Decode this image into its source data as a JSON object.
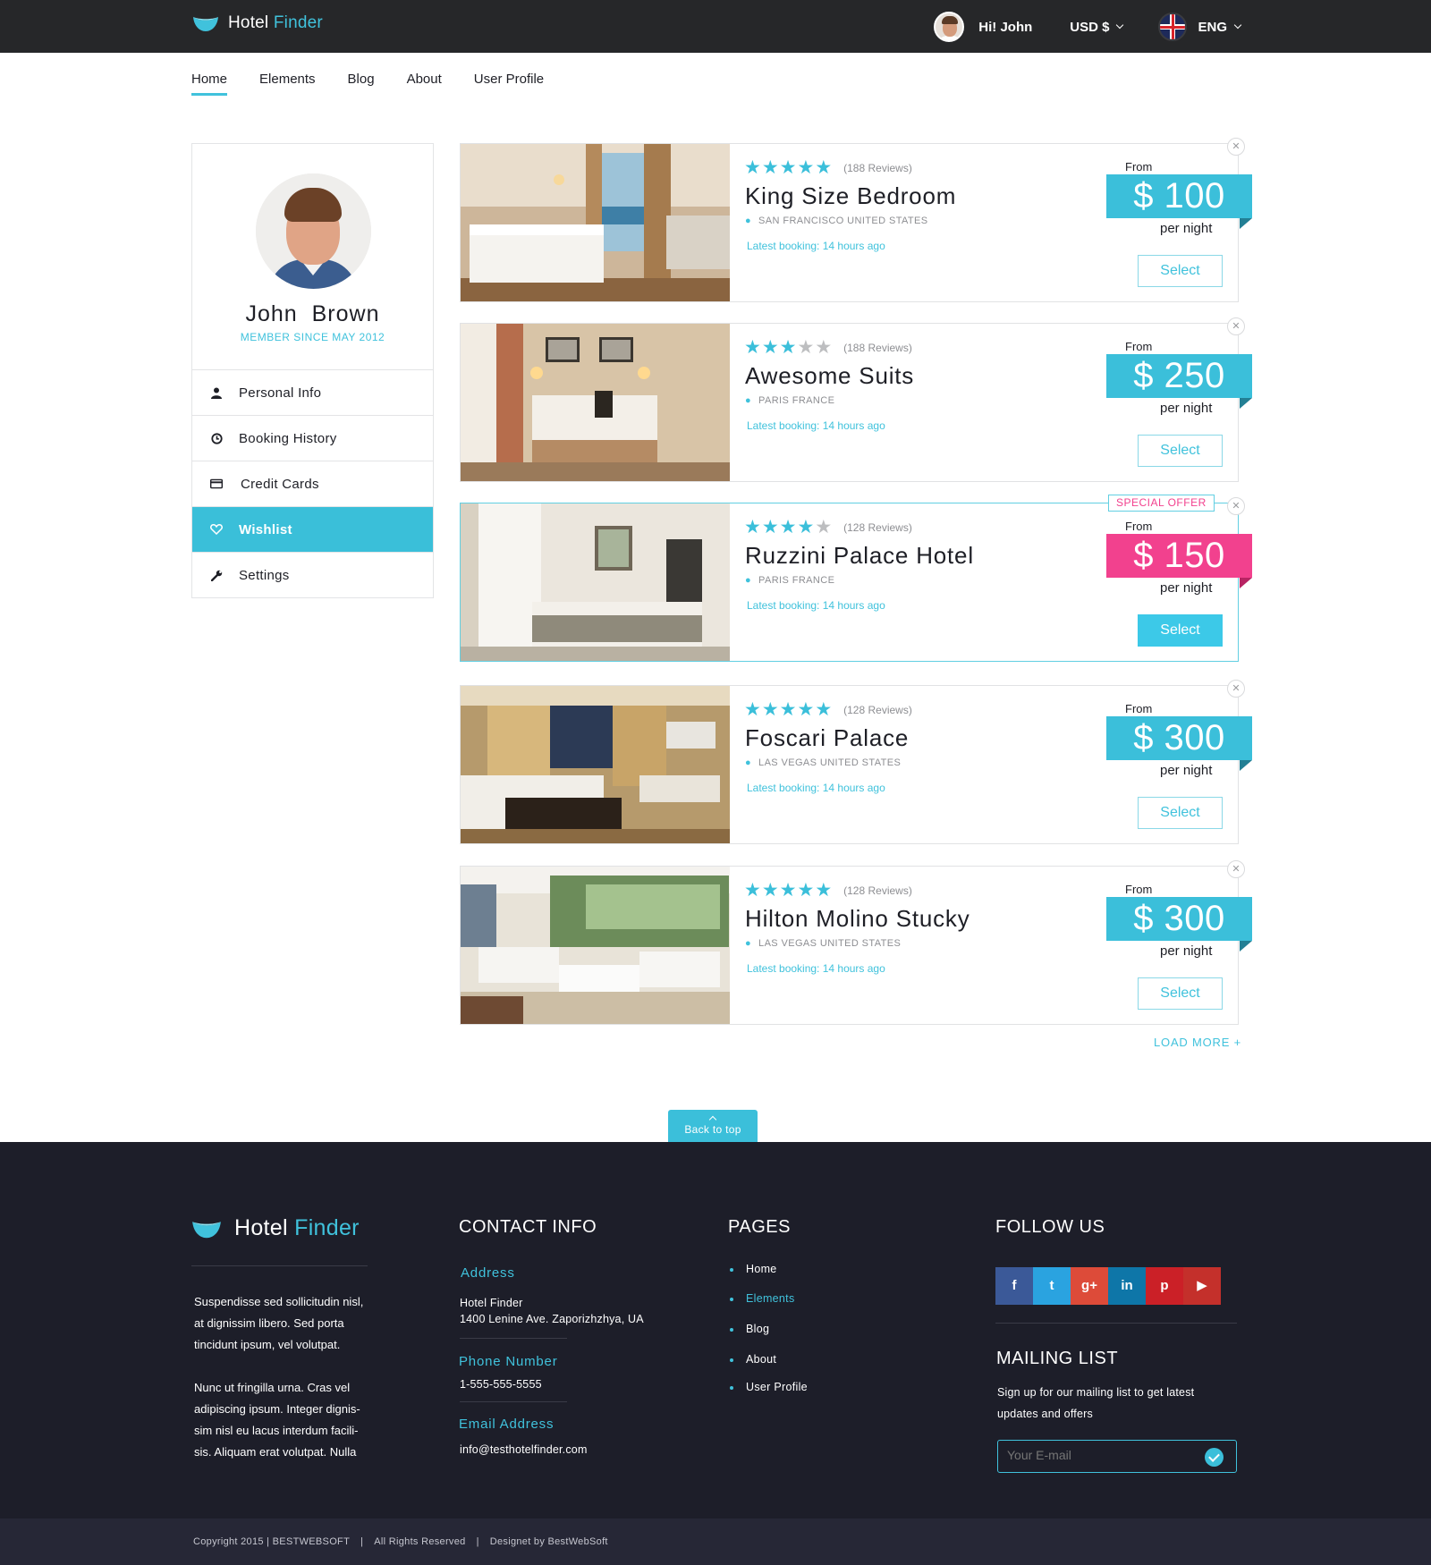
{
  "brand": {
    "name_part1": "Hotel",
    "name_part2": "Finder",
    "accent": "#40c2dc"
  },
  "topbar": {
    "greeting": "Hi! John",
    "currency": "USD  $",
    "language": "ENG"
  },
  "nav": [
    {
      "label": "Home",
      "active": true
    },
    {
      "label": "Elements"
    },
    {
      "label": "Blog"
    },
    {
      "label": "About"
    },
    {
      "label": "User Profile"
    }
  ],
  "profile": {
    "first_name": "John",
    "last_name": "Brown",
    "since": "MEMBER SINCE MAY 2012",
    "menu": [
      {
        "label": "Personal Info",
        "icon": "user-icon"
      },
      {
        "label": "Booking History",
        "icon": "clock-icon"
      },
      {
        "label": "Credit Cards",
        "icon": "credit-card-icon"
      },
      {
        "label": "Wishlist",
        "icon": "heart-icon",
        "active": true
      },
      {
        "label": "Settings",
        "icon": "wrench-icon"
      }
    ]
  },
  "hotels": [
    {
      "stars": 5,
      "reviews": "(188 Reviews)",
      "name": "King Size Bedroom",
      "location": "SAN FRANCISCO UNITED STATES",
      "latest": "Latest booking: 14 hours ago",
      "from": "From",
      "price": "$ 100",
      "per": "per night",
      "select": "Select"
    },
    {
      "stars": 3,
      "reviews": "(188 Reviews)",
      "name": "Awesome Suits",
      "location": "PARIS FRANCE",
      "latest": "Latest booking: 14 hours ago",
      "from": "From",
      "price": "$ 250",
      "per": "per night",
      "select": "Select"
    },
    {
      "stars": 4,
      "reviews": "(128 Reviews)",
      "name": "Ruzzini Palace Hotel",
      "location": "PARIS FRANCE",
      "latest": "Latest booking: 14 hours ago",
      "from": "From",
      "price": "$ 150",
      "per": "per night",
      "select": "Select",
      "special": "SPECIAL OFFER"
    },
    {
      "stars": 5,
      "reviews": "(128 Reviews)",
      "name": "Foscari Palace",
      "location": "LAS VEGAS UNITED STATES",
      "latest": "Latest booking: 14 hours ago",
      "from": "From",
      "price": "$ 300",
      "per": "per night",
      "select": "Select"
    },
    {
      "stars": 5,
      "reviews": "(128 Reviews)",
      "name": "Hilton Molino Stucky",
      "location": "LAS VEGAS UNITED STATES",
      "latest": "Latest booking: 14 hours ago",
      "from": "From",
      "price": "$ 300",
      "per": "per night",
      "select": "Select"
    }
  ],
  "load_more": "LOAD MORE +",
  "back_to_top": "Back to top",
  "footer": {
    "about_p1": "Suspendisse sed sollicitudin nisl, at dignissim libero. Sed porta tincidunt ipsum, vel volutpat.",
    "about_p2": "Nunc ut fringilla urna. Cras vel adipiscing ipsum. Integer dignis-sim nisl eu lacus interdum facili-sis. Aliquam erat volutpat. Nulla",
    "contact": {
      "heading": "CONTACT INFO",
      "address_label": "Address",
      "address_line1": "Hotel Finder",
      "address_line2": "1400 Lenine Ave. Zaporizhzhya, UA",
      "phone_label": "Phone Number",
      "phone": "1-555-555-5555",
      "email_label": "Email Address",
      "email": "info@testhotelfinder.com"
    },
    "pages": {
      "heading": "PAGES",
      "links": [
        "Home",
        "Elements",
        "Blog",
        "About",
        "User Profile"
      ]
    },
    "follow": {
      "heading": "FOLLOW US",
      "networks": [
        {
          "name": "facebook",
          "glyph": "f",
          "color": "#3b5998"
        },
        {
          "name": "twitter",
          "glyph": "t",
          "color": "#2aa3e0"
        },
        {
          "name": "google-plus",
          "glyph": "g+",
          "color": "#dd4b39"
        },
        {
          "name": "linkedin",
          "glyph": "in",
          "color": "#0e76a8"
        },
        {
          "name": "pinterest",
          "glyph": "p",
          "color": "#cb2027"
        },
        {
          "name": "youtube",
          "glyph": "▶",
          "color": "#c4302b"
        }
      ]
    },
    "mailing": {
      "heading": "MAILING LIST",
      "text": "Sign up for our mailing list to get latest updates and offers",
      "placeholder": "Your E-mail"
    }
  },
  "copyright": {
    "part1": "Copyright  2015  | BESTWEBSOFT",
    "part2": "All Rights Reserved",
    "part3": "Designet by BestWebSoft"
  }
}
